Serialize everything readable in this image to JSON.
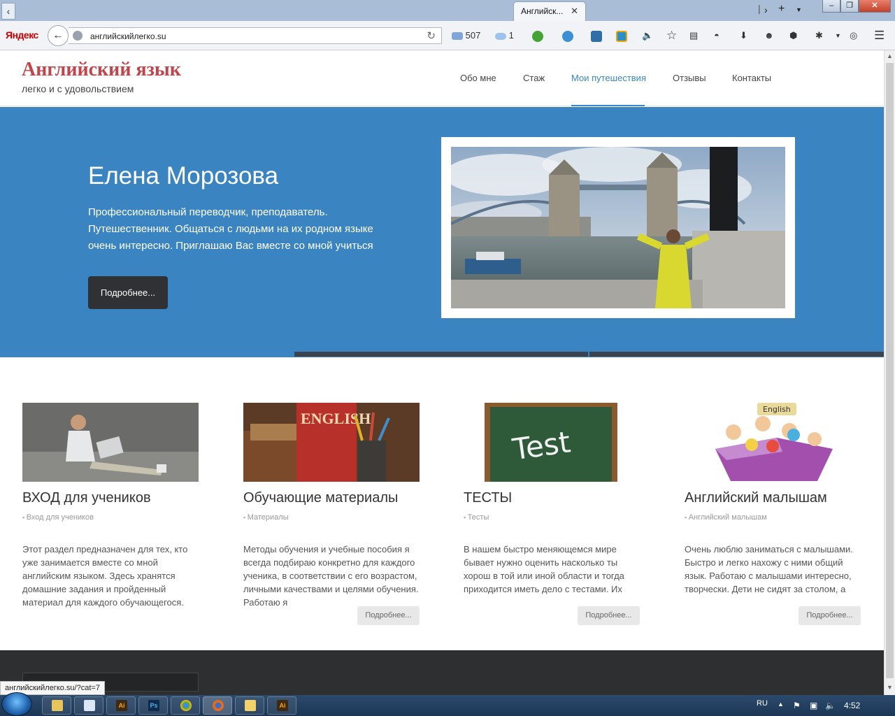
{
  "browser": {
    "tab_title": "Английск...",
    "url": "английскийлегко.su",
    "brand": "Яндекс",
    "mail_count": "507",
    "cloud_count": "1",
    "status_url": "английскийлегко.su/?cat=7"
  },
  "site": {
    "logo_title": "Английский язык",
    "logo_subtitle": "легко и с удовольствием",
    "nav": [
      {
        "label": "Обо мне"
      },
      {
        "label": "Стаж"
      },
      {
        "label": "Мои путешествия"
      },
      {
        "label": "Отзывы"
      },
      {
        "label": "Контакты"
      }
    ],
    "hero": {
      "name": "Елена Морозова",
      "text": "Профессиональный переводчик, преподаватель. Путешественник. Общаться с людьми на их родном языке очень интересно. Приглашаю Вас вместе со мной учиться",
      "button": "Подробнее..."
    },
    "cards": [
      {
        "title": "ВХОД для учеников",
        "category": "Вход для учеников",
        "text": "Этот раздел предназначен для тех, кто уже занимается вместе со мной английским языком. Здесь хранятся домашние задания и пройденный материал для каждого обучающегося.",
        "more": ""
      },
      {
        "title": "Обучающие материалы",
        "category": "Материалы",
        "text": "Методы обучения и учебные пособия я всегда подбираю конкретно для каждого ученика, в соответствии с его возрастом, личными качествами и целями обучения. Работаю я",
        "more": "Подробнее..."
      },
      {
        "title": "ТЕСТЫ",
        "category": "Тесты",
        "text": "В нашем быстро меняющемся мире бывает нужно оценить насколько ты хорош в той или иной области и тогда приходится иметь дело с тестами. Их",
        "more": "Подробнее..."
      },
      {
        "title": "Английский малышам",
        "category": "Английский малышам",
        "text": "Очень люблю заниматься с малышами. Быстро и легко нахожу с ними общий язык. Работаю с малышами интересно, творчески. Дети не сидят за столом, а",
        "more": "Подробнее..."
      }
    ],
    "card_images": {
      "book_text": "ENGLISH",
      "board_text": "Test",
      "kids_text": "English"
    }
  },
  "taskbar": {
    "lang": "RU",
    "clock": "4:52"
  }
}
